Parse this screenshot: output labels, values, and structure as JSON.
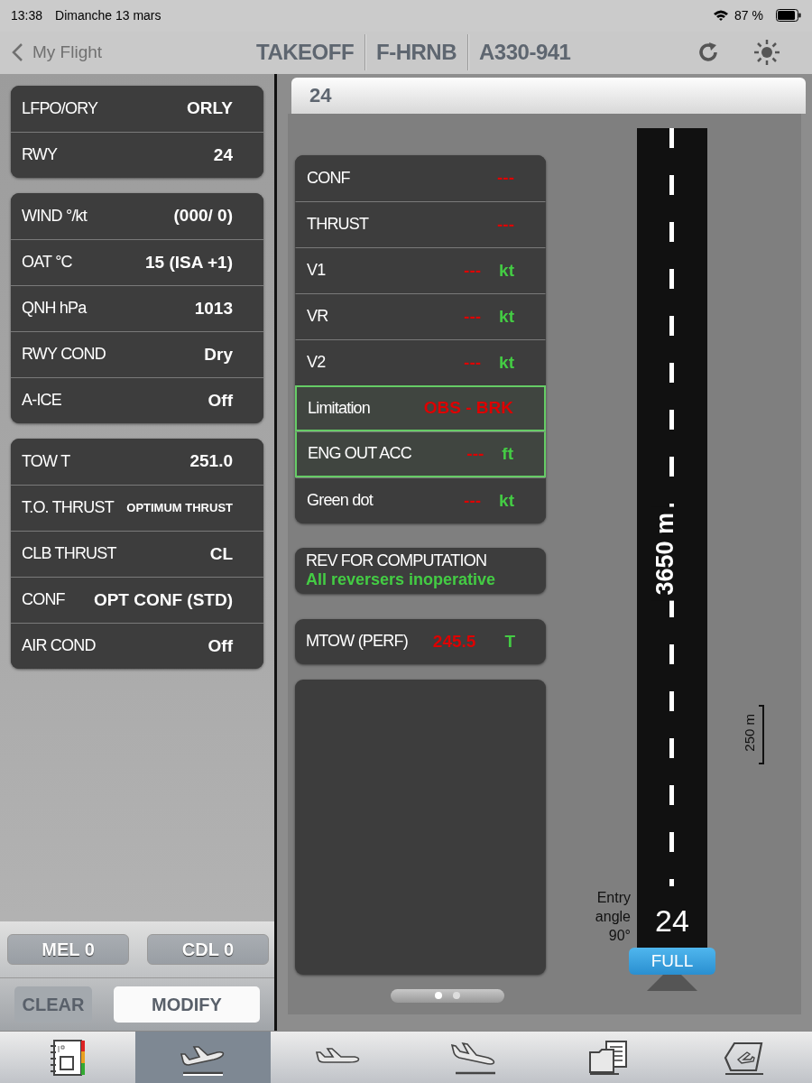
{
  "status_bar": {
    "time": "13:38",
    "date": "Dimanche 13 mars",
    "battery": "87 %"
  },
  "nav": {
    "back": "My Flight",
    "title_segments": [
      "TAKEOFF",
      "F-HRNB",
      "A330-941"
    ]
  },
  "input_groups": [
    [
      {
        "label": "LFPO/ORY",
        "value": "ORLY"
      },
      {
        "label": "RWY",
        "value": "24"
      }
    ],
    [
      {
        "label": "WIND  °/kt",
        "value": "(000/ 0)"
      },
      {
        "label": "OAT °C",
        "value": "15 (ISA +1)"
      },
      {
        "label": "QNH  hPa",
        "value": "1013"
      },
      {
        "label": "RWY COND",
        "value": "Dry"
      },
      {
        "label": "A-ICE",
        "value": "Off"
      }
    ],
    [
      {
        "label": "TOW  T",
        "value": "251.0"
      },
      {
        "label": "T.O. THRUST",
        "value": "OPTIMUM THRUST",
        "small": true
      },
      {
        "label": "CLB THRUST",
        "value": "CL"
      },
      {
        "label": "CONF",
        "value": "OPT CONF (STD)"
      },
      {
        "label": "AIR COND",
        "value": "Off"
      }
    ]
  ],
  "list_buttons": [
    "MEL 0",
    "CDL 0"
  ],
  "actions": {
    "clear": "CLEAR",
    "modify": "MODIFY"
  },
  "runway_header": "24",
  "results": [
    {
      "label": "CONF",
      "value": "---",
      "highlighted": false
    },
    {
      "label": "THRUST",
      "value": "---",
      "highlighted": false
    },
    {
      "label": "V1",
      "value": "---",
      "unit": "kt",
      "highlighted": false
    },
    {
      "label": "VR",
      "value": "---",
      "unit": "kt",
      "highlighted": false
    },
    {
      "label": "V2",
      "value": "---",
      "unit": "kt",
      "highlighted": false
    },
    {
      "label": "Limitation",
      "value": "OBS - BRK",
      "highlighted": true
    },
    {
      "label": "ENG OUT ACC",
      "value": "---",
      "unit": "ft",
      "highlighted": true
    },
    {
      "label": "Green dot",
      "value": "---",
      "unit": "kt",
      "highlighted": false
    }
  ],
  "reversers": {
    "title": "REV FOR COMPUTATION",
    "value": "All reversers inoperative"
  },
  "mtow": {
    "label": "MTOW (PERF)",
    "value": "245.5",
    "unit": "T"
  },
  "page_dots": [
    {
      "selected": true
    },
    {
      "selected": false
    }
  ],
  "runway": {
    "length": "3650 m",
    "number": "24",
    "entry_angle": "Entry angle 90°",
    "intersection": "FULL",
    "scale": "250 m"
  },
  "tabs": [
    {
      "kind": "eqrh",
      "selected": false
    },
    {
      "kind": "takeoff",
      "selected": true
    },
    {
      "kind": "cruise",
      "selected": false
    },
    {
      "kind": "landing",
      "selected": false
    },
    {
      "kind": "documents",
      "selected": false
    },
    {
      "kind": "tail",
      "selected": false
    }
  ]
}
